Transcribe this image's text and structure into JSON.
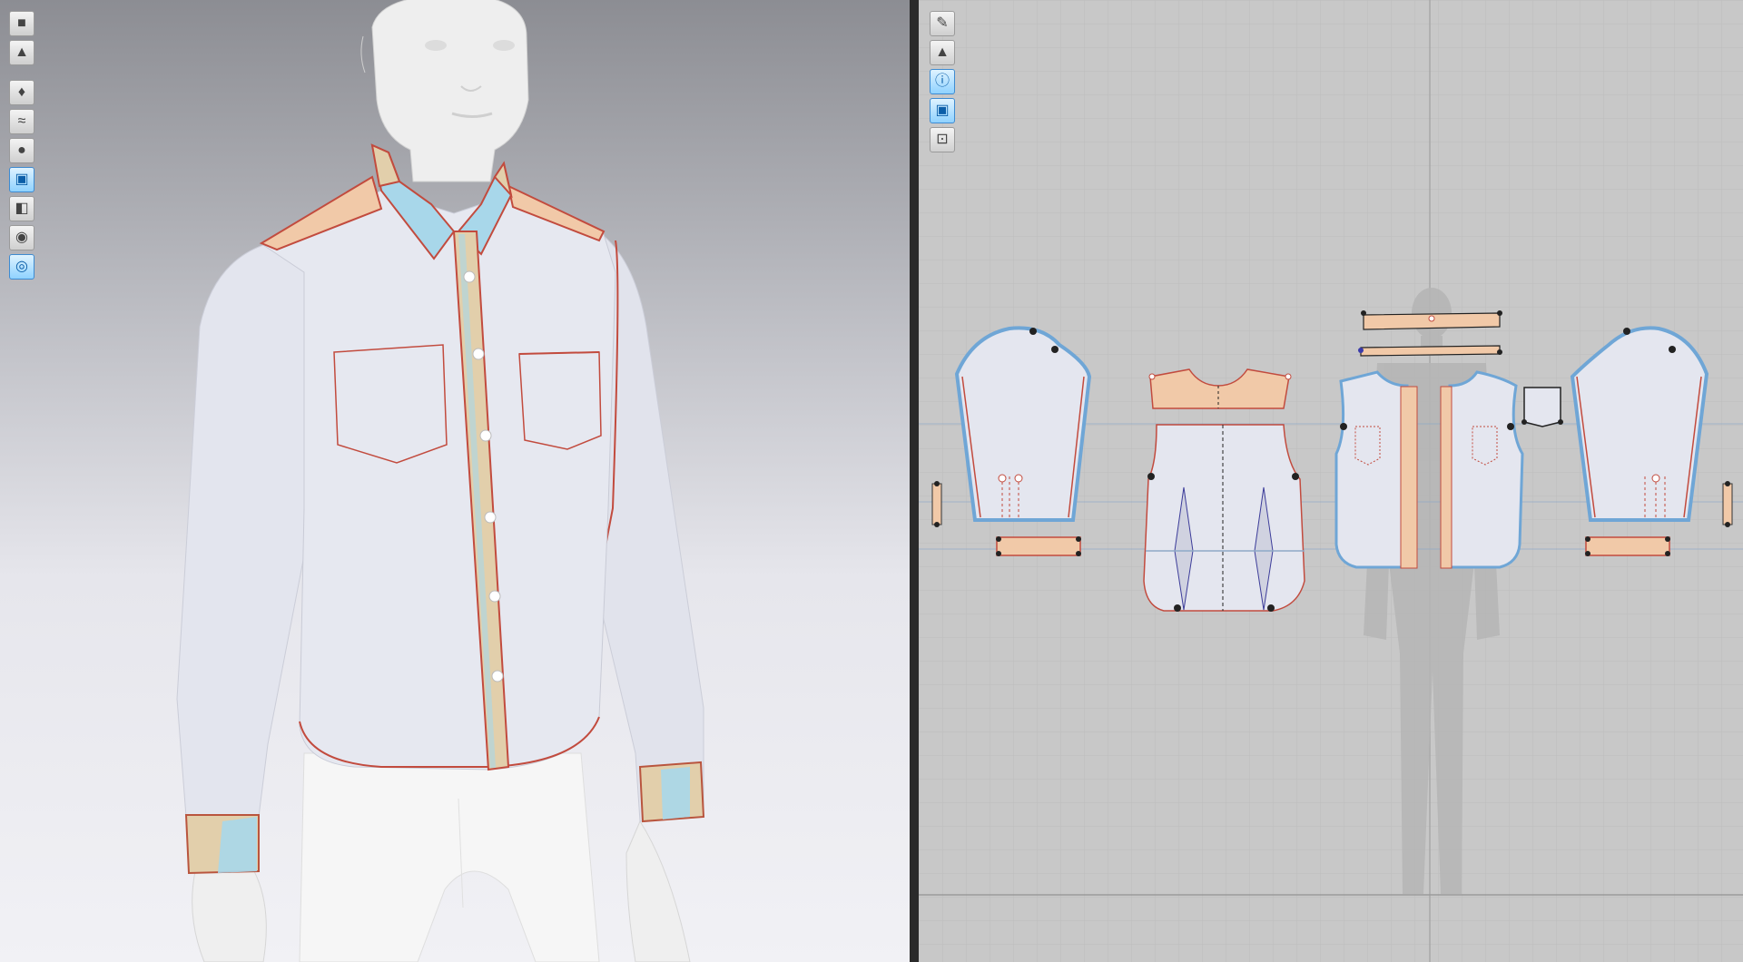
{
  "viewport3d": {
    "toolbar": [
      {
        "icon": "display-cube-icon"
      },
      {
        "icon": "garment-icon"
      },
      {
        "icon": "avatar-shirt-icon"
      },
      {
        "icon": "cloth-wrinkle-icon"
      },
      {
        "icon": "avatar-icon"
      },
      {
        "icon": "texture-icon",
        "active": true
      },
      {
        "icon": "mesh-icon"
      },
      {
        "icon": "avatar-head-icon"
      },
      {
        "icon": "globe-icon",
        "active": true
      }
    ]
  },
  "viewport2d": {
    "toolbar": [
      {
        "icon": "brush-icon"
      },
      {
        "icon": "shirt-pattern-icon"
      },
      {
        "icon": "info-icon",
        "active": true
      },
      {
        "icon": "texture-2d-icon",
        "active": true
      },
      {
        "icon": "lock-shirt-icon"
      }
    ]
  },
  "colors": {
    "fabric": "#e4e6ef",
    "seam": "#c24b3e",
    "yoke": "#f1c9a8",
    "interfacing": "#a8d7ea",
    "outline_selected": "#6fa6d6"
  }
}
